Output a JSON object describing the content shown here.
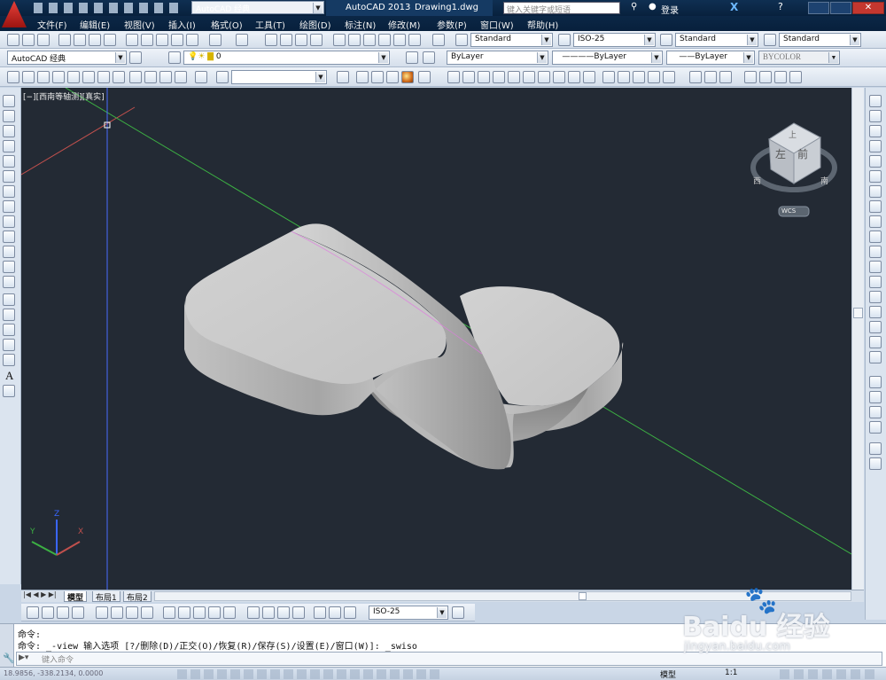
{
  "title_bar": {
    "workspace": "AutoCAD 经典",
    "app_name": "AutoCAD 2013",
    "file_name": "Drawing1.dwg",
    "search_placeholder": "键入关键字或短语",
    "login": "登录"
  },
  "menu": [
    "文件(F)",
    "编辑(E)",
    "视图(V)",
    "插入(I)",
    "格式(O)",
    "工具(T)",
    "绘图(D)",
    "标注(N)",
    "修改(M)",
    "参数(P)",
    "窗口(W)",
    "帮助(H)"
  ],
  "styles_toolbar": {
    "text_style": "Standard",
    "dim_style": "ISO-25",
    "table_style": "Standard",
    "mleader_style": "Standard"
  },
  "workspace_toolbar": {
    "workspace": "AutoCAD 经典",
    "layer": "0"
  },
  "properties_toolbar": {
    "color": "ByLayer",
    "linetype": "ByLayer",
    "lineweight": "ByLayer",
    "plot_style": "BYCOLOR"
  },
  "viewport": {
    "label": "[−][西南等轴测][真实]",
    "viewcube": {
      "top": "上",
      "left": "左",
      "front": "前",
      "west": "西",
      "south": "南"
    },
    "wcs": "WCS",
    "ucs": {
      "x": "X",
      "y": "Y",
      "z": "Z"
    }
  },
  "layout_tabs": [
    "模型",
    "布局1",
    "布局2"
  ],
  "dim_toolbar": {
    "dim_style": "ISO-25"
  },
  "command": {
    "line1": "命令:",
    "line2": "命令:  _-view 输入选项 [?/删除(D)/正交(O)/恢复(R)/保存(S)/设置(E)/窗口(W)]: _swiso",
    "placeholder": "键入命令"
  },
  "status": {
    "coords": "18.9856, -338.2134, 0.0000",
    "model": "模型",
    "scale": "1:1"
  },
  "watermark": {
    "brand": "Baidu 经验",
    "url": "jingyan.baidu.com"
  },
  "colors": {
    "viewport_bg": "#232a34",
    "title_bg": "#0b2746",
    "x_axis": "#c0504d",
    "y_axis": "#3cb043",
    "z_axis": "#3a66ff",
    "solid": "#cfcfcf"
  }
}
